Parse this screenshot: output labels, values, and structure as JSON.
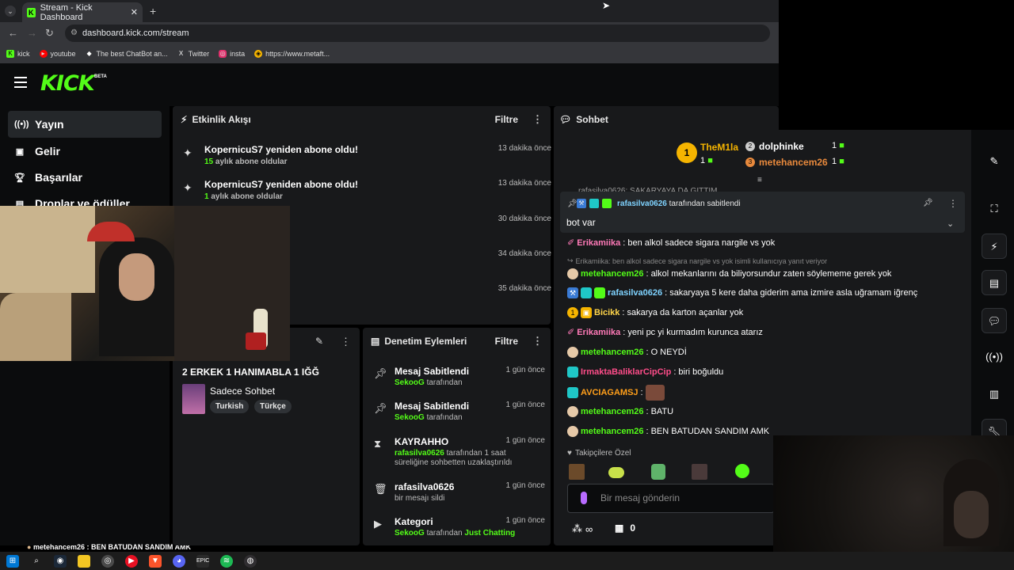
{
  "browser": {
    "tab_title": "Stream - Kick Dashboard",
    "url": "dashboard.kick.com/stream",
    "bookmarks": [
      {
        "label": "kick",
        "icon": "kick-icon",
        "color": "#53fc18"
      },
      {
        "label": "youtube",
        "icon": "youtube-icon",
        "color": "#ff0000"
      },
      {
        "label": "The best ChatBot an...",
        "icon": "chatbot-icon",
        "color": "#ffffff"
      },
      {
        "label": "Twitter",
        "icon": "x-icon",
        "color": "#ffffff"
      },
      {
        "label": "insta",
        "icon": "instagram-icon",
        "color": "#e1306c"
      },
      {
        "label": "https://www.metaft...",
        "icon": "shield-icon",
        "color": "#f5b400"
      }
    ]
  },
  "brand": {
    "logo": "KICK",
    "beta": "BETA",
    "accent": "#53fc18"
  },
  "sidebar": {
    "items": [
      {
        "label": "Yayın",
        "icon": "broadcast-icon"
      },
      {
        "label": "Gelir",
        "icon": "revenue-icon"
      },
      {
        "label": "Başarılar",
        "icon": "trophy-icon"
      },
      {
        "label": "Droplar ve ödüller",
        "icon": "gift-icon"
      }
    ],
    "bottom_message": "metehancem26 : BEN BATUDAN SANDIM AMK"
  },
  "activity": {
    "title": "Etkinlik Akışı",
    "filter": "Filtre",
    "items": [
      {
        "title": "KopernicuS7 yeniden abone oldu!",
        "num": "15",
        "sub": "aylık abone oldular",
        "time": "13 dakika önce"
      },
      {
        "title": "KopernicuS7 yeniden abone oldu!",
        "num": "1",
        "sub": "aylık abone oldular",
        "time": "13 dakika önce"
      },
      {
        "time": "30 dakika önce"
      },
      {
        "time": "34 dakika önce"
      },
      {
        "time": "35 dakika önce"
      }
    ]
  },
  "stream_info": {
    "title": "2 ERKEK 1 HANIMABLA 1 IĞĞ",
    "category": "Sadece Sohbet",
    "tags": [
      "Turkish",
      "Türkçe"
    ]
  },
  "moderation": {
    "title": "Denetim Eylemleri",
    "filter": "Filtre",
    "items": [
      {
        "icon": "pin-icon",
        "title": "Mesaj Sabitlendi",
        "user": "SekooG",
        "desc": "tarafından",
        "time": "1 gün önce"
      },
      {
        "icon": "pin-icon",
        "title": "Mesaj Sabitlendi",
        "user": "SekooG",
        "desc": "tarafından",
        "time": "1 gün önce"
      },
      {
        "icon": "hourglass-icon",
        "title": "KAYRAHHO",
        "user": "rafasilva0626",
        "desc": "tarafından 1 saat süreliğine sohbetten uzaklaştırıldı",
        "time": "1 gün önce"
      },
      {
        "icon": "trash-icon",
        "title": "rafasilva0626",
        "user": "",
        "desc": "bir mesajı sildi",
        "time": "1 gün önce"
      },
      {
        "icon": "category-icon",
        "title": "Kategori",
        "user": "SekooG",
        "desc": "tarafından",
        "extra": "Just Chatting",
        "time": "1 gün önce"
      }
    ]
  },
  "chat": {
    "title": "Sohbet",
    "top_gifters": [
      {
        "name": "TheM1la",
        "count": "1",
        "rank": "1",
        "color": "#f5b400"
      },
      {
        "name": "dolphinke",
        "count": "1",
        "rank": "2",
        "color": "#ffffff"
      },
      {
        "name": "metehancem26",
        "count": "1",
        "rank": "3",
        "color": "#e8893c"
      }
    ],
    "partial_line": "rafasilva0626: SAKARYAYA DA GİTTİM",
    "pinned": {
      "user": "rafasilva0626",
      "suffix": "tarafından sabitlendi",
      "message": "bot var"
    },
    "messages": [
      {
        "user": "Erikamiika",
        "text": "ben alkol sadece sigara nargile vs yok",
        "color": "#ff7ab8"
      },
      {
        "reply": "Erikamiika: ben alkol sadece sigara nargile vs yok isimli kullanıcıya yanıt veriyor"
      },
      {
        "user": "metehancem26",
        "text": "alkol mekanlarını da biliyorsundur zaten söylememe gerek yok",
        "color": "#53fc18"
      },
      {
        "user": "rafasilva0626",
        "text": "sakaryaya 5 kere daha giderim ama izmire asla uğramam iğrenç",
        "color": "#7fd3ff"
      },
      {
        "user": "Bicikk",
        "text": "sakarya da karton açanlar yok",
        "color": "#ffd54a"
      },
      {
        "user": "Erikamiika",
        "text": "yeni pc yi kurmadım kurunca atarız",
        "color": "#ff7ab8"
      },
      {
        "user": "metehancem26",
        "text": "O NEYDİ",
        "color": "#53fc18"
      },
      {
        "user": "IrmaktaBaliklarCipCip",
        "text": "biri boğuldu",
        "color": "#ff4d8a"
      },
      {
        "user": "AVCIAGAMSJ",
        "text": "",
        "color": "#ff9f1a"
      },
      {
        "user": "metehancem26",
        "text": "BATU",
        "color": "#53fc18"
      },
      {
        "user": "metehancem26",
        "text": "BEN BATUDAN SANDIM AMK",
        "color": "#53fc18"
      }
    ],
    "followers_only": "Takipçilere Özel",
    "input_placeholder": "Bir mesaj gönderin",
    "footer_infinity": "∞",
    "footer_count": "0"
  },
  "rail_icons": [
    "pencil-icon",
    "screenshot-icon",
    "lightning-icon",
    "notes-icon",
    "chat-icon",
    "broadcast-icon",
    "layout-icon",
    "wrench-icon"
  ]
}
